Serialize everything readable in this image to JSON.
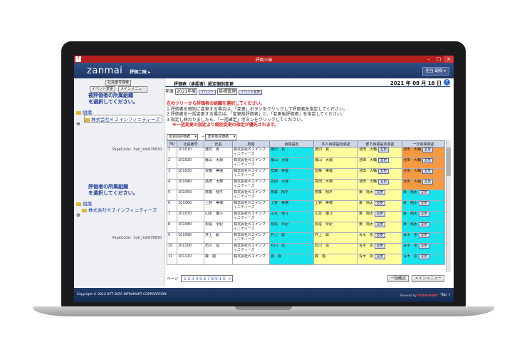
{
  "window": {
    "title": "評価三昧",
    "icon": "f"
  },
  "brand": {
    "logo": "zanmai",
    "system_menu": "評価二昧 ▸",
    "user": "担当 副様 ▾"
  },
  "left": {
    "btn_shain": "社員番号検索",
    "btn_event": "イベント変更",
    "btn_mainmenu": "メインメニュー",
    "section1": {
      "heading1": "被評価者の所属組織",
      "heading2": "を選択してください。",
      "root": "組織",
      "child": "株式会社Ｋ２インフィニティーズ",
      "pagecode": "PageCode：hyk_link676630"
    },
    "section2": {
      "heading1": "評価者の所属組織",
      "heading2": "を選択してください。",
      "root": "組織",
      "child": "株式会社Ｋ２インフィニティーズ",
      "pagecode": "PageCode：hyk_link676630"
    }
  },
  "main": {
    "title": "評価表（承認者）設定個別変更",
    "date": "2021 年 08 月 18 日",
    "year_label": "年度",
    "year_value": "2021年度",
    "tab_event": "イベント",
    "tab_target": "目標管理",
    "tab_change": "イベント変更",
    "instructions": {
      "l1": "左のツリーから評価者の組織を選択してください。",
      "l2": "1.評価者を個別に変更する場合は、「変更」ボタンをクリックして評価者を指定してください。",
      "l3": "2.評価者を一括変更する場合は、「変更前評価者」と、「変更後評価者」を指定してください。",
      "l4": "3.指定し終わりましたら、「一括確定」ボタンをクリックしてください。",
      "l5": "※一括変更の指定より個別変更の指定が優先されます。"
    },
    "select_before": "変更前評価者",
    "select_after": "変更後評価者",
    "columns": [
      "No",
      "社員番号",
      "氏名",
      "所属",
      "目標設定",
      "本人目標設定承認",
      "部下目標設定承認",
      "一次目標承認"
    ],
    "change_label": "変更",
    "rows": [
      {
        "no": "1",
        "id": "101010",
        "name": "渡辺　貴",
        "dept": "株式会社Ｋ２インフ",
        "dept2": "ィニティーズ",
        "c4": "渡辺　貴",
        "c5": "渡辺　貴",
        "c6": "池田　大輔",
        "c7": "池田　大輔"
      },
      {
        "no": "2",
        "id": "101020",
        "name": "篠山　大陽",
        "dept": "株式会社Ｋ２インフ",
        "dept2": "ィニティーズ",
        "c4": "篠山　大陽",
        "c5": "篠山　大陽",
        "c6": "池田　大輔",
        "c7": "池田　大輔"
      },
      {
        "no": "3",
        "id": "101030",
        "name": "安藤　美優",
        "dept": "株式会社Ｋ２インフ",
        "dept2": "ィニティーズ",
        "c4": "安藤　美優",
        "c5": "安藤　美優",
        "c6": "池田　大輔",
        "c7": "池田　大輔"
      },
      {
        "no": "4",
        "id": "101040",
        "name": "高田　大輝",
        "dept": "株式会社Ｋ２インフ",
        "dept2": "ィニティーズ",
        "c4": "高田　大輝",
        "c5": "高田　大輝",
        "c6": "池田　大輔",
        "c7": "池田　大輔"
      },
      {
        "no": "5",
        "id": "101050",
        "name": "斎藤　翔平",
        "dept": "株式会社Ｋ２インフ",
        "dept2": "ィニティーズ",
        "c4": "斎藤　翔平",
        "c5": "斎藤　翔平",
        "c6": "東　翔太",
        "c7": "東　翔太"
      },
      {
        "no": "6",
        "id": "101060",
        "name": "上野　美穂",
        "dept": "株式会社Ｋ２インフ",
        "dept2": "ィニティーズ",
        "c4": "上野　美穂",
        "c5": "上野　美穂",
        "c6": "東　翔太",
        "c7": "東　翔太"
      },
      {
        "no": "7",
        "id": "101070",
        "name": "山本　優斗",
        "dept": "株式会社Ｋ２インフ",
        "dept2": "ィニティーズ",
        "c4": "山本　優斗",
        "c5": "山本　優斗",
        "c6": "東　翔太",
        "c7": "東　翔太"
      },
      {
        "no": "8",
        "id": "101080",
        "name": "松尾　早紀",
        "dept": "株式会社Ｋ２インフ",
        "dept2": "ィニティーズ",
        "c4": "松尾　早紀",
        "c5": "松尾　早紀",
        "c6": "東　翔太",
        "c7": "東　翔太"
      },
      {
        "no": "9",
        "id": "101090",
        "name": "井上　聡",
        "dept": "株式会社Ｋ２インフ",
        "dept2": "ィニティーズ",
        "c4": "井上　聡",
        "c5": "井上　聡",
        "c6": "青木　崇",
        "c7": "青木　崇"
      },
      {
        "no": "10",
        "id": "101100",
        "name": "石川　遥",
        "dept": "株式会社Ｋ２インフ",
        "dept2": "ィニティーズ",
        "c4": "石川　遥",
        "c5": "石川　遥",
        "c6": "青木　崇",
        "c7": "青木　崇"
      },
      {
        "no": "11",
        "id": "101110",
        "name": "森　楓",
        "dept": "株式会社Ｋ２インフ",
        "dept2": "",
        "c4": "森　楓",
        "c5": "森　楓",
        "c6": "青木　崇",
        "c7": "青木　崇"
      }
    ],
    "pager_label": "ページ",
    "pager_pages": "１２３４５６７８９１０ →",
    "btn_confirm": "一括確定",
    "btn_menu": "メインメニュー"
  },
  "footer": {
    "copyright": "Copyright © 2012 NTT DATA INTRAMART CORPORATION",
    "powered_prefix": "Powered by",
    "powered_brand": "intra-mart",
    "top": "Top ⇧"
  },
  "colors": {
    "cyan": "#19e3ea",
    "yellow": "#ffff9e",
    "orange": "#f59a42",
    "navy": "#1d3563",
    "titlebar": "#b51f1f"
  }
}
